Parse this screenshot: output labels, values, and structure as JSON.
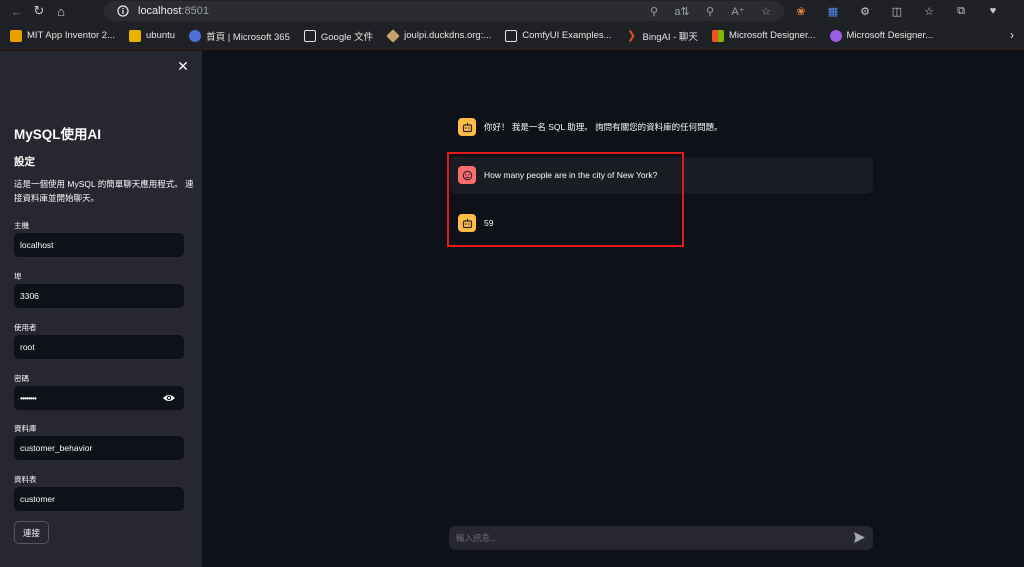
{
  "browser": {
    "url_host": "localhost",
    "url_port": ":8501",
    "bookmarks": [
      {
        "label": "MIT App Inventor 2...",
        "color": "#e8a000"
      },
      {
        "label": "ubuntu",
        "color": "#e8b400"
      },
      {
        "label": "首頁 | Microsoft 365",
        "color": "#4d6fd8"
      },
      {
        "label": "Google 文件",
        "color": "#e3e3e3"
      },
      {
        "label": "joulpi.duckdns.org:...",
        "color": "#c4a46b"
      },
      {
        "label": "ComfyUI Examples...",
        "color": "#e3e3e3"
      },
      {
        "label": "BingAI - 聊天",
        "color": "#e05020"
      },
      {
        "label": "Microsoft Designer...",
        "color": "#f25022"
      },
      {
        "label": "Microsoft Designer...",
        "color": "#9b5de5"
      }
    ]
  },
  "sidebar": {
    "title": "MySQL使用AI",
    "subtitle": "設定",
    "description": "這是一個使用 MySQL 的簡單聊天應用程式。 連接資料庫並開始聊天。",
    "fields": [
      {
        "label": "主機",
        "value": "localhost"
      },
      {
        "label": "埠",
        "value": "3306"
      },
      {
        "label": "使用者",
        "value": "root"
      },
      {
        "label": "密碼",
        "value": "••••••••"
      },
      {
        "label": "資料庫",
        "value": "customer_behavior"
      },
      {
        "label": "資料表",
        "value": "customer"
      }
    ],
    "connect_label": "連接"
  },
  "chat": {
    "messages": [
      {
        "role": "assistant",
        "text": "你好！ 我是一名 SQL 助理。 詢問有關您的資料庫的任何問題。"
      },
      {
        "role": "user",
        "text": "How many people are in the city of New York?"
      },
      {
        "role": "assistant",
        "text": "59"
      }
    ],
    "input_placeholder": "輸入訊息..."
  },
  "colors": {
    "bot_avatar": "#ffbd45",
    "user_avatar": "#ff6c6c",
    "highlight": "#e11b1b"
  }
}
